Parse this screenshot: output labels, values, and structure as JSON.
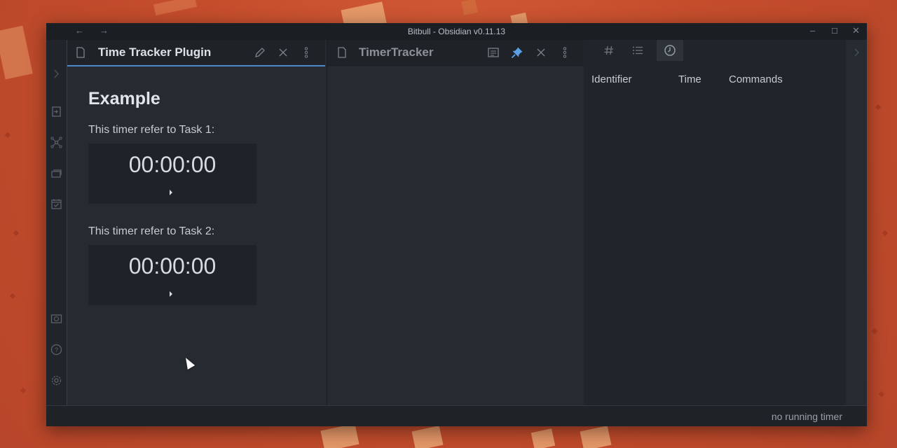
{
  "window": {
    "title": "Bitbull - Obsidian v0.11.13"
  },
  "pane_left": {
    "tab_title": "Time Tracker Plugin",
    "heading": "Example",
    "timers": [
      {
        "label": "This timer refer to Task 1:",
        "time": "00:00:00"
      },
      {
        "label": "This timer refer to Task 2:",
        "time": "00:00:00"
      }
    ]
  },
  "pane_right": {
    "tab_title": "TimerTracker"
  },
  "sidebar": {
    "columns": [
      "Identifier",
      "Time",
      "Commands"
    ]
  },
  "status": {
    "text": "no running timer"
  },
  "colors": {
    "accent": "#4c88c9",
    "pin": "#5aa0e6",
    "background": "#262a31"
  }
}
